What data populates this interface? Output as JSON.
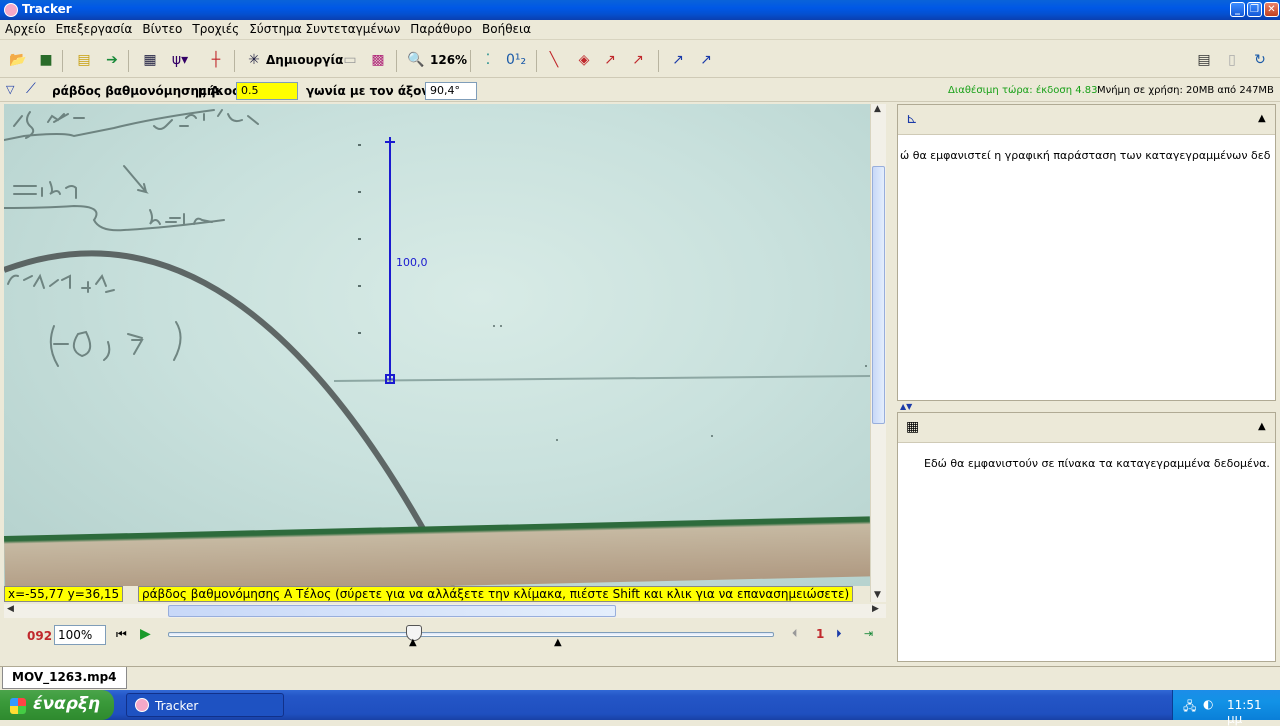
{
  "window": {
    "title": "Tracker"
  },
  "menu": [
    "Αρχείο",
    "Επεξεργασία",
    "Βίντεο",
    "Τροχιές",
    "Σύστημα Συντεταγμένων",
    "Παράθυρο",
    "Βοήθεια"
  ],
  "toolbar": {
    "create_label": "Δημιουργία",
    "zoom_label": "126%"
  },
  "track": {
    "name": "ράβδος βαθμονόμησης Α",
    "length_label": "μήκος",
    "length_value": "0.5",
    "angle_label": "γωνία με τον άξονα x",
    "angle_value": "90,4°",
    "update_notice": "Διαθέσιμη τώρα: έκδοση 4.83",
    "memory": "Μνήμη σε χρήση: 20MB από 247MB"
  },
  "video": {
    "stick_label": "100,0",
    "coords": "x=-55,77  y=36,15",
    "status": "ράβδος βαθμονόμησης Α Τέλος (σύρετε για να αλλάξετε την κλίμακα, πιέστε Shift και κλικ για να επανασημειώσετε)"
  },
  "player": {
    "frame": "092",
    "rate": "100%",
    "step": "1",
    "position": 0.41
  },
  "panels": {
    "plot_msg": "ώ θα εμφανιστεί η γραφική παράσταση των καταγεγραμμένων δεδομένων",
    "table_msg": "Εδώ θα εμφανιστούν σε πίνακα τα καταγεγραμμένα δεδομένα."
  },
  "tabs": [
    "MOV_1263.mp4"
  ],
  "taskbar": {
    "start": "έναρξη",
    "task": "Tracker",
    "clock": "11:51 μμ"
  }
}
